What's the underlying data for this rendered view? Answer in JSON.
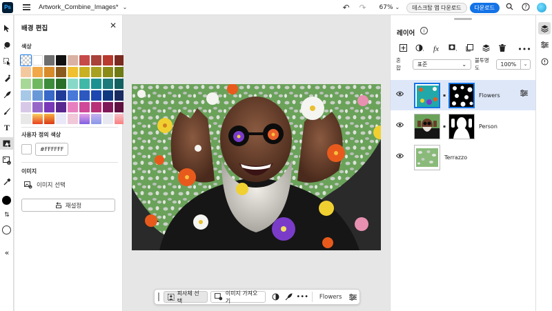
{
  "app": {
    "logo": "Ps",
    "document_title": "Artwork_Combine_Images*"
  },
  "topbar": {
    "zoom": "67%",
    "desktop_button": "데스크탑 앱 다운로드",
    "download_button": "다운로드",
    "icons": [
      "undo-icon",
      "redo-icon",
      "search-icon",
      "help-icon",
      "avatar"
    ]
  },
  "tools": [
    "move",
    "lasso",
    "object-select",
    "healing",
    "quick-actions",
    "brush",
    "type",
    "background",
    "image-import",
    "eyedropper",
    "foreground-color",
    "swap",
    "background-color",
    "collapse"
  ],
  "properties": {
    "title": "배경 편집",
    "color_section": "색상",
    "swatches": [
      "transparent",
      "#ffffff",
      "#6e6e6e",
      "#111111",
      "#d9b2a3",
      "#c74a4a",
      "#a8423a",
      "#b83a2e",
      "#7a2a1e",
      "#f4c89e",
      "#f0a848",
      "#d88b2a",
      "#8a5a1e",
      "#f0c030",
      "#c8b020",
      "#a8a020",
      "#8a8a18",
      "#6e7a14",
      "#a8d898",
      "#70b860",
      "#3c8c3c",
      "#2a6e2a",
      "#88d8c8",
      "#40b8a8",
      "#1c9090",
      "#1c7a7a",
      "#146060",
      "#a8c8e8",
      "#6898d8",
      "#3868c8",
      "#203c98",
      "#4878d8",
      "#2c58c0",
      "#1c48b0",
      "#103880",
      "#182a60",
      "#d8c8e8",
      "#9868c8",
      "#7838b8",
      "#582890",
      "#e880c0",
      "#d04898",
      "#b83078",
      "#801858",
      "#601040",
      "#e8e8e8",
      "gradient-sunset",
      "gradient-orange",
      "#e8e8f8",
      "#f0c8d8",
      "gradient-purple",
      "gradient-lilac",
      "#e8e8f0",
      "gradient-pink"
    ],
    "custom_section": "사용자 정의 색상",
    "custom_hex": "#FFFFFF",
    "image_section": "이미지",
    "image_select": "이미지 선택",
    "reset": "재설정"
  },
  "taskbar": {
    "select_subject": "피사체 선택",
    "import_image": "이미지 가져오기",
    "layer_name": "Flowers"
  },
  "layers": {
    "title": "레이어",
    "blend_label": "혼합",
    "blend_mode": "표준",
    "opacity_label": "불투명도",
    "opacity_value": "100%",
    "items": [
      {
        "name": "Flowers",
        "selected": true
      },
      {
        "name": "Person",
        "selected": false
      },
      {
        "name": "Terrazzo",
        "selected": false
      }
    ]
  },
  "colors": {
    "accent": "#1473e6",
    "selected_layer_bg": "#dde7f8",
    "terrazzo_green": "#6aa25a"
  }
}
